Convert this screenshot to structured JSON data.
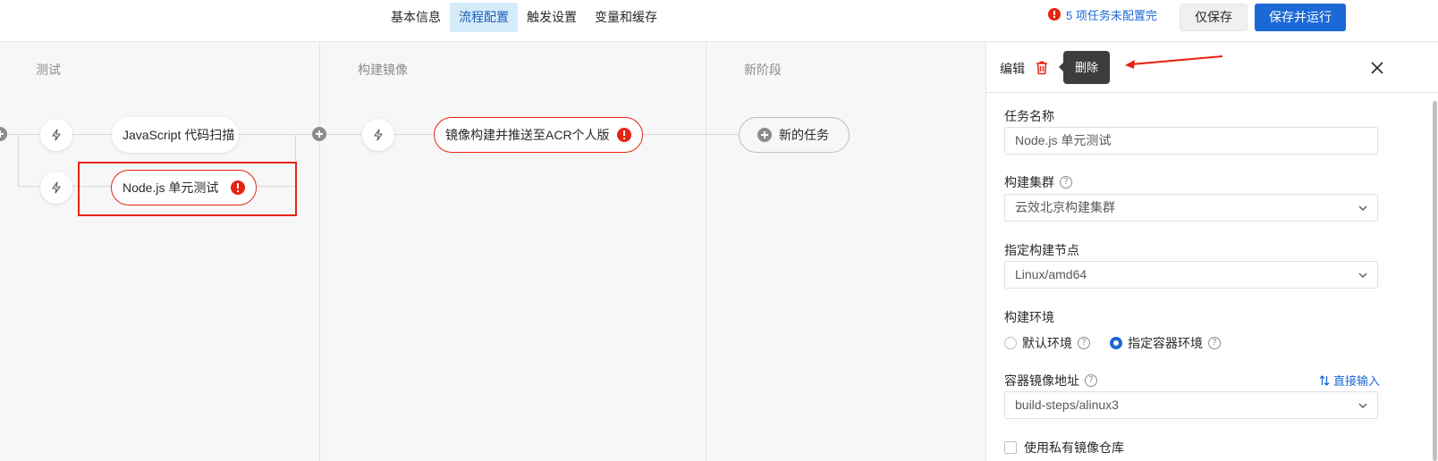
{
  "header": {
    "tabs": [
      {
        "label": "基本信息",
        "active": false
      },
      {
        "label": "流程配置",
        "active": true
      },
      {
        "label": "触发设置",
        "active": false
      },
      {
        "label": "变量和缓存",
        "active": false
      }
    ],
    "warning_text": "5 项任务未配置完",
    "save_label": "仅保存",
    "save_run_label": "保存并运行"
  },
  "pipeline": {
    "stages": [
      {
        "title": "测试",
        "jobs": [
          "JavaScript 代码扫描",
          "Node.js 单元测试"
        ]
      },
      {
        "title": "构建镜像",
        "jobs": [
          "镜像构建并推送至ACR个人版"
        ]
      },
      {
        "title": "新阶段",
        "new_task_label": "新的任务"
      }
    ]
  },
  "panel": {
    "title": "编辑",
    "tooltip": "删除",
    "task_name_label": "任务名称",
    "task_name_value": "Node.js 单元测试",
    "cluster_label": "构建集群",
    "cluster_value": "云效北京构建集群",
    "node_label": "指定构建节点",
    "node_value": "Linux/amd64",
    "env_label": "构建环境",
    "env_options": [
      {
        "label": "默认环境",
        "selected": false
      },
      {
        "label": "指定容器环境",
        "selected": true
      }
    ],
    "image_label": "容器镜像地址",
    "direct_input_label": "直接输入",
    "image_value": "build-steps/alinux3",
    "private_repo_label": "使用私有镜像仓库"
  },
  "colors": {
    "accent": "#1b69d6",
    "error": "#e62412",
    "active_tab_bg": "#d6ebfa"
  }
}
